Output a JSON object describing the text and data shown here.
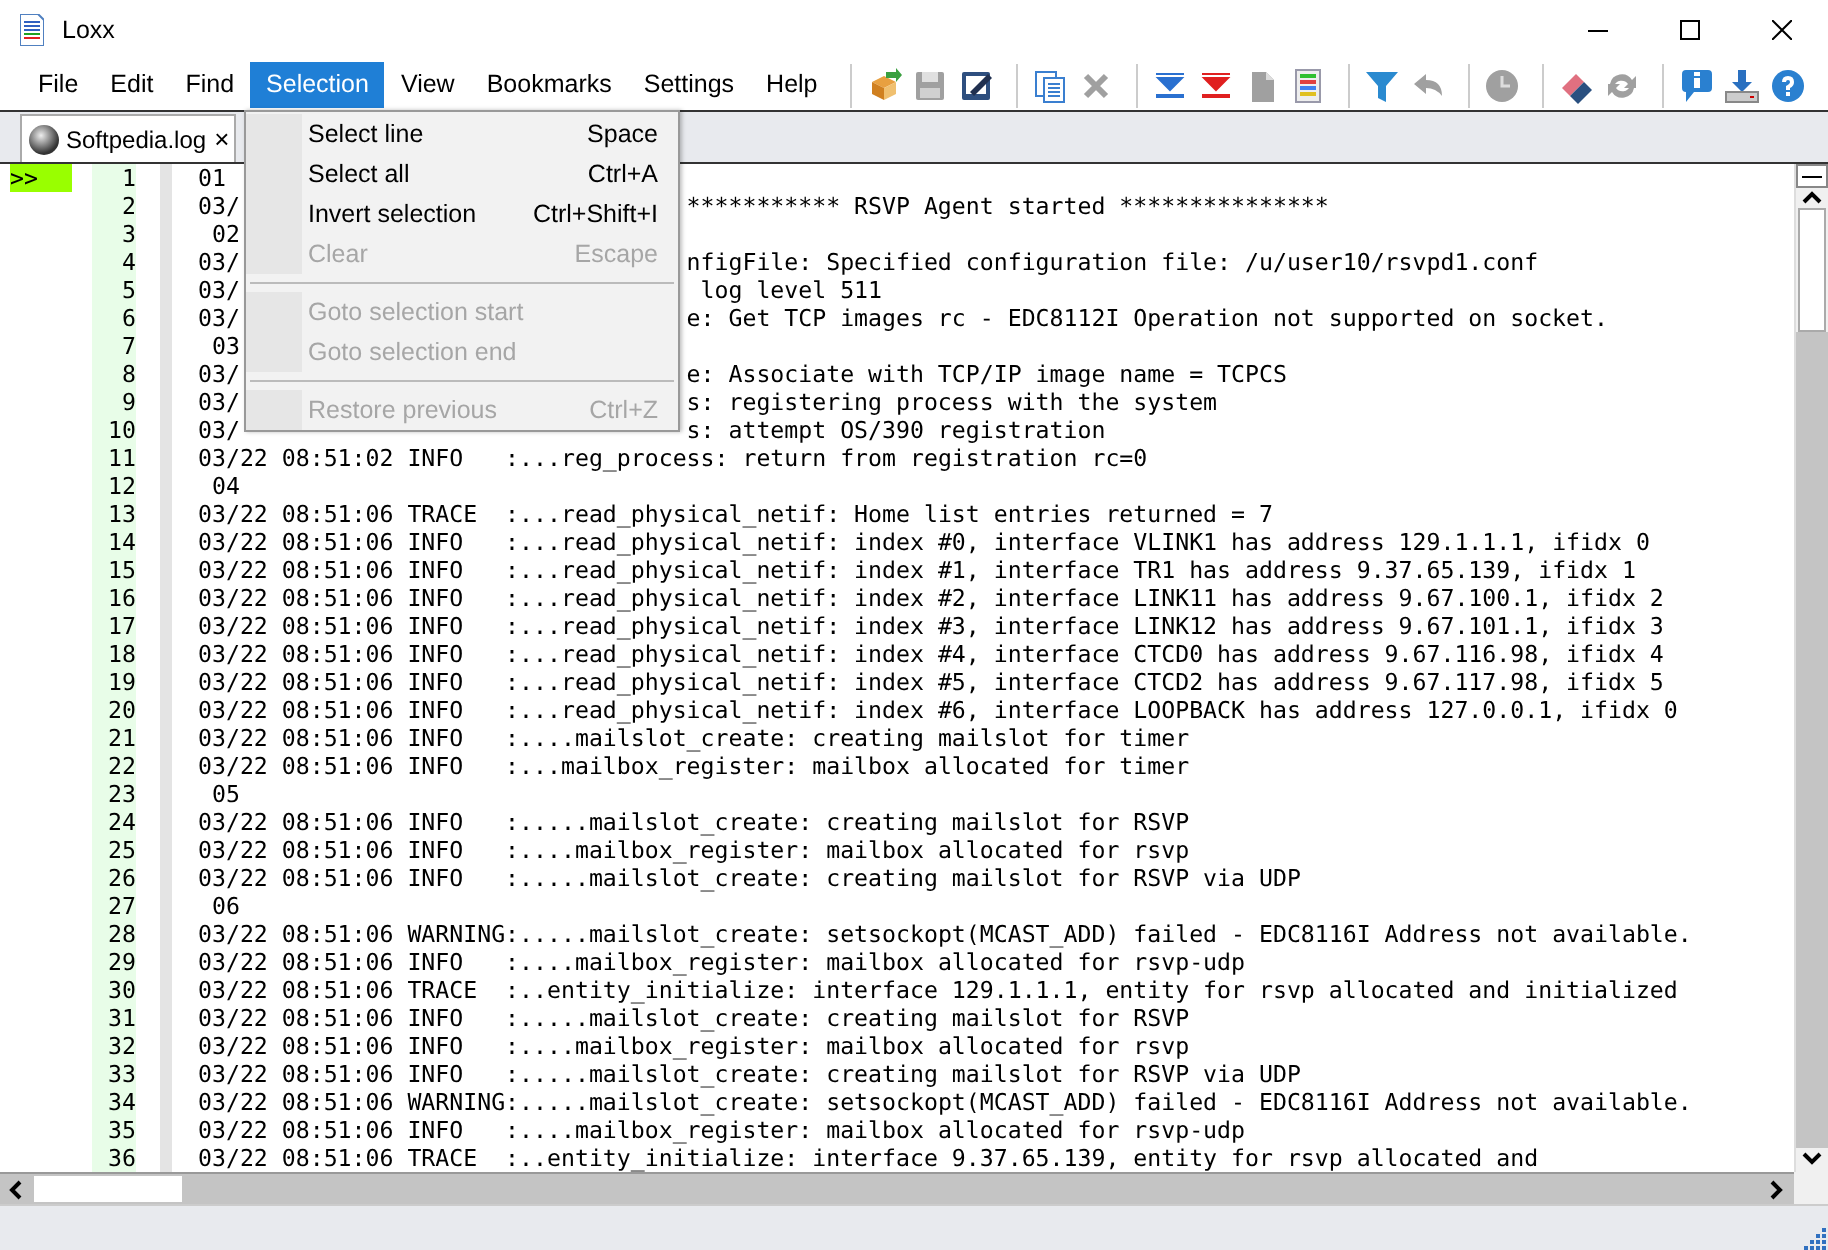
{
  "window": {
    "title": "Loxx"
  },
  "menubar": [
    {
      "label": "File",
      "selected": false
    },
    {
      "label": "Edit",
      "selected": false
    },
    {
      "label": "Find",
      "selected": false
    },
    {
      "label": "Selection",
      "selected": true
    },
    {
      "label": "View",
      "selected": false
    },
    {
      "label": "Bookmarks",
      "selected": false
    },
    {
      "label": "Settings",
      "selected": false
    },
    {
      "label": "Help",
      "selected": false
    }
  ],
  "toolbar": [
    {
      "kind": "separator"
    },
    {
      "kind": "open",
      "disabled": false
    },
    {
      "kind": "save",
      "disabled": true
    },
    {
      "kind": "save-as",
      "disabled": false
    },
    {
      "kind": "separator"
    },
    {
      "kind": "copy",
      "disabled": false
    },
    {
      "kind": "delete",
      "disabled": true
    },
    {
      "kind": "separator"
    },
    {
      "kind": "mark-blue",
      "disabled": false
    },
    {
      "kind": "mark-red",
      "disabled": false
    },
    {
      "kind": "document",
      "disabled": true
    },
    {
      "kind": "color-list",
      "disabled": false
    },
    {
      "kind": "separator"
    },
    {
      "kind": "filter",
      "disabled": false
    },
    {
      "kind": "undo",
      "disabled": true
    },
    {
      "kind": "separator"
    },
    {
      "kind": "clock",
      "disabled": true
    },
    {
      "kind": "separator"
    },
    {
      "kind": "eraser",
      "disabled": false
    },
    {
      "kind": "refresh",
      "disabled": true
    },
    {
      "kind": "separator"
    },
    {
      "kind": "info",
      "disabled": false
    },
    {
      "kind": "download",
      "disabled": false
    },
    {
      "kind": "help",
      "disabled": false
    }
  ],
  "tabs": [
    {
      "label": "Softpedia.log",
      "close": "×",
      "selected": true
    }
  ],
  "menu": [
    {
      "kind": "item",
      "label": "Select line",
      "shortcut": "Space",
      "disabled": false
    },
    {
      "kind": "item",
      "label": "Select all",
      "shortcut": "Ctrl+A",
      "disabled": false
    },
    {
      "kind": "item",
      "label": "Invert selection",
      "shortcut": "Ctrl+Shift+I",
      "disabled": false
    },
    {
      "kind": "item",
      "label": "Clear",
      "shortcut": "Escape",
      "disabled": true
    },
    {
      "kind": "separator"
    },
    {
      "kind": "item",
      "label": "Goto selection start",
      "disabled": true
    },
    {
      "kind": "item",
      "label": "Goto selection end",
      "disabled": true
    },
    {
      "kind": "separator"
    },
    {
      "kind": "item",
      "label": "Restore previous",
      "shortcut": "Ctrl+Z",
      "disabled": true
    }
  ],
  "log": {
    "rows": [
      {
        "number": "1",
        "marker": ">>",
        "text": "01"
      },
      {
        "number": "2",
        "text": "03/",
        "text_right": "*********** RSVP Agent started ***************"
      },
      {
        "number": "3",
        "text": " 02"
      },
      {
        "number": "4",
        "text": "03/",
        "text_right": "nfigFile: Specified configuration file: /u/user10/rsvpd1.conf"
      },
      {
        "number": "5",
        "text": "03/",
        "text_right": " log level 511"
      },
      {
        "number": "6",
        "text": "03/",
        "text_right": "e: Get TCP images rc - EDC8112I Operation not supported on socket."
      },
      {
        "number": "7",
        "text": " 03"
      },
      {
        "number": "8",
        "text": "03/",
        "text_right": "e: Associate with TCP/IP image name = TCPCS"
      },
      {
        "number": "9",
        "text": "03/",
        "text_right": "s: registering process with the system"
      },
      {
        "number": "10",
        "text": "03/",
        "text_right": "s: attempt OS/390 registration"
      },
      {
        "number": "11",
        "text": "03/22 08:51:02 INFO   :...reg_process: return from registration rc=0"
      },
      {
        "number": "12",
        "text": " 04"
      },
      {
        "number": "13",
        "text": "03/22 08:51:06 TRACE  :...read_physical_netif: Home list entries returned = 7"
      },
      {
        "number": "14",
        "text": "03/22 08:51:06 INFO   :...read_physical_netif: index #0, interface VLINK1 has address 129.1.1.1, ifidx 0"
      },
      {
        "number": "15",
        "text": "03/22 08:51:06 INFO   :...read_physical_netif: index #1, interface TR1 has address 9.37.65.139, ifidx 1"
      },
      {
        "number": "16",
        "text": "03/22 08:51:06 INFO   :...read_physical_netif: index #2, interface LINK11 has address 9.67.100.1, ifidx 2"
      },
      {
        "number": "17",
        "text": "03/22 08:51:06 INFO   :...read_physical_netif: index #3, interface LINK12 has address 9.67.101.1, ifidx 3"
      },
      {
        "number": "18",
        "text": "03/22 08:51:06 INFO   :...read_physical_netif: index #4, interface CTCD0 has address 9.67.116.98, ifidx 4"
      },
      {
        "number": "19",
        "text": "03/22 08:51:06 INFO   :...read_physical_netif: index #5, interface CTCD2 has address 9.67.117.98, ifidx 5"
      },
      {
        "number": "20",
        "text": "03/22 08:51:06 INFO   :...read_physical_netif: index #6, interface LOOPBACK has address 127.0.0.1, ifidx 0"
      },
      {
        "number": "21",
        "text": "03/22 08:51:06 INFO   :....mailslot_create: creating mailslot for timer"
      },
      {
        "number": "22",
        "text": "03/22 08:51:06 INFO   :...mailbox_register: mailbox allocated for timer"
      },
      {
        "number": "23",
        "text": " 05"
      },
      {
        "number": "24",
        "text": "03/22 08:51:06 INFO   :.....mailslot_create: creating mailslot for RSVP"
      },
      {
        "number": "25",
        "text": "03/22 08:51:06 INFO   :....mailbox_register: mailbox allocated for rsvp"
      },
      {
        "number": "26",
        "text": "03/22 08:51:06 INFO   :.....mailslot_create: creating mailslot for RSVP via UDP"
      },
      {
        "number": "27",
        "text": " 06"
      },
      {
        "number": "28",
        "text": "03/22 08:51:06 WARNING:.....mailslot_create: setsockopt(MCAST_ADD) failed - EDC8116I Address not available."
      },
      {
        "number": "29",
        "text": "03/22 08:51:06 INFO   :....mailbox_register: mailbox allocated for rsvp-udp"
      },
      {
        "number": "30",
        "text": "03/22 08:51:06 TRACE  :..entity_initialize: interface 129.1.1.1, entity for rsvp allocated and initialized"
      },
      {
        "number": "31",
        "text": "03/22 08:51:06 INFO   :.....mailslot_create: creating mailslot for RSVP"
      },
      {
        "number": "32",
        "text": "03/22 08:51:06 INFO   :....mailbox_register: mailbox allocated for rsvp"
      },
      {
        "number": "33",
        "text": "03/22 08:51:06 INFO   :.....mailslot_create: creating mailslot for RSVP via UDP"
      },
      {
        "number": "34",
        "text": "03/22 08:51:06 WARNING:.....mailslot_create: setsockopt(MCAST_ADD) failed - EDC8116I Address not available."
      },
      {
        "number": "35",
        "text": "03/22 08:51:06 INFO   :....mailbox_register: mailbox allocated for rsvp-udp"
      },
      {
        "number": "36",
        "text": "03/22 08:51:06 TRACE  :..entity_initialize: interface 9.37.65.139, entity for rsvp allocated and"
      }
    ]
  }
}
